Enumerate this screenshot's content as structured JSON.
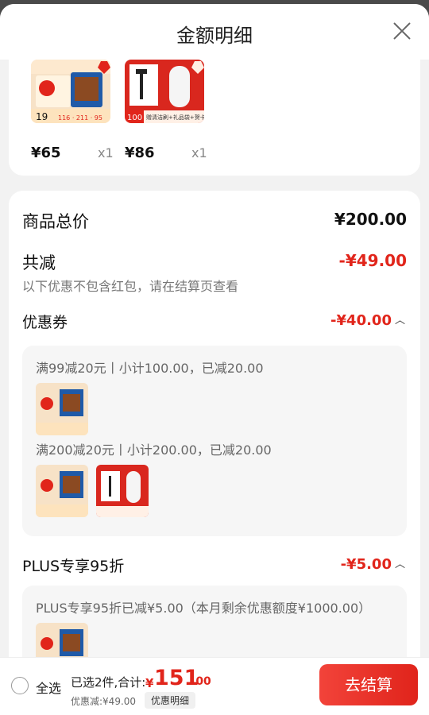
{
  "header": {
    "title": "金额明细"
  },
  "items": [
    {
      "price": "¥65",
      "qty": "x1"
    },
    {
      "price": "¥86",
      "qty": "x1"
    }
  ],
  "summary": {
    "goods_total_label": "商品总价",
    "goods_total_value": "¥200.00",
    "total_discount_label": "共减",
    "total_discount_value": "-¥49.00",
    "note": "以下优惠不包含红包，请在结算页查看"
  },
  "coupon": {
    "label": "优惠券",
    "value": "-¥40.00",
    "lines": [
      "满99减20元丨小计100.00，已减20.00",
      "满200减20元丨小计200.00，已减20.00"
    ]
  },
  "plus": {
    "label": "PLUS专享95折",
    "value": "-¥5.00",
    "line": "PLUS专享95折已减¥5.00（本月剩余优惠额度¥1000.00）"
  },
  "thumb_text": {
    "p1_price": "19",
    "p1_tag": "116 · 211 · 95",
    "p2_price": "100",
    "p2_tag": "赠清洁刷+礼品袋+贺卡"
  },
  "bottom": {
    "select_all": "全选",
    "selected_text": "已选2件,合计:",
    "currency": "¥",
    "total_int": "151",
    "total_dec": ".00",
    "discount_note": "优惠减:¥49.00",
    "detail_button": "优惠明细",
    "checkout_button": "去结算"
  },
  "colors": {
    "accent": "#e1251b",
    "background": "#f2f2f2"
  },
  "icons": [
    "close-icon",
    "caret-up-icon",
    "radio-icon"
  ]
}
